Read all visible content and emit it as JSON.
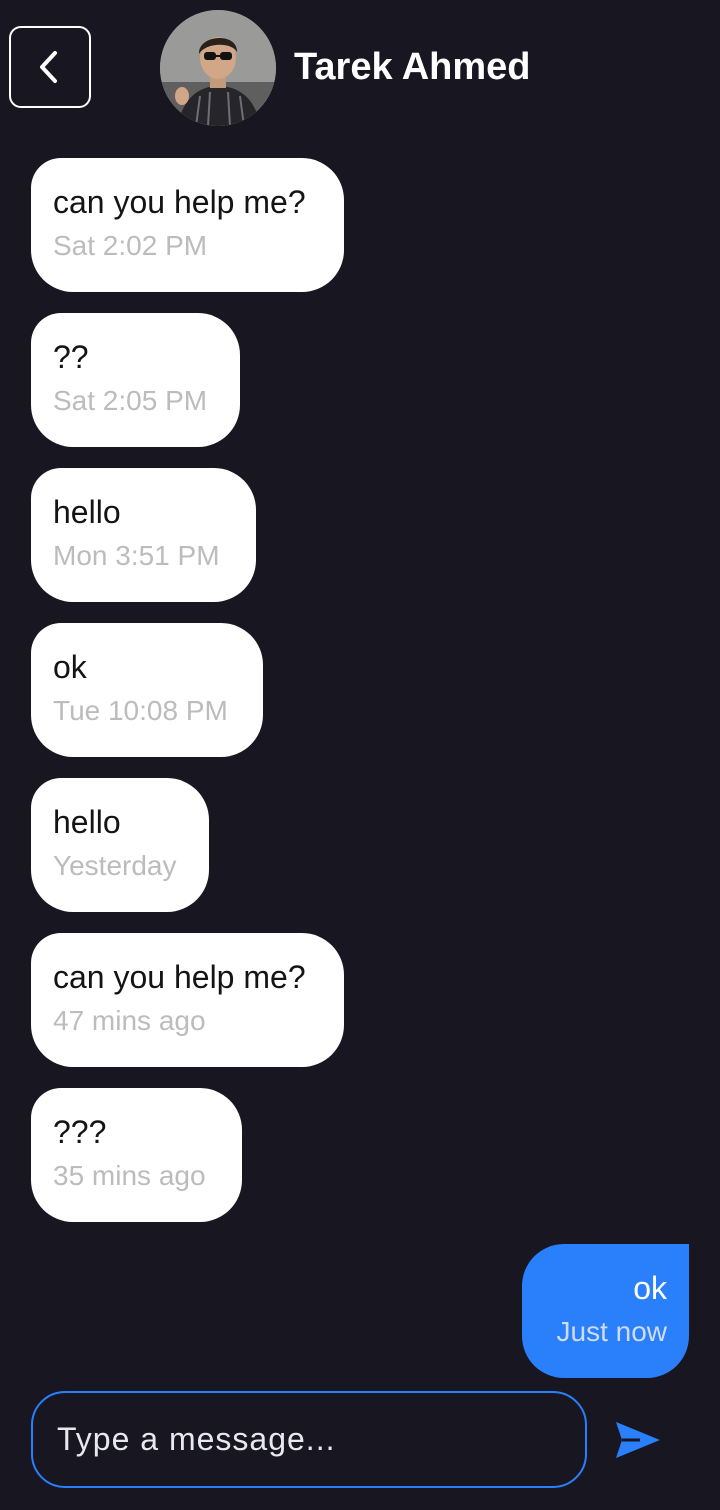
{
  "header": {
    "contact_name": "Tarek Ahmed"
  },
  "messages": [
    {
      "direction": "incoming",
      "text": "can you help me?",
      "time": "Sat 2:02 PM"
    },
    {
      "direction": "incoming",
      "text": "??",
      "time": "Sat 2:05 PM"
    },
    {
      "direction": "incoming",
      "text": "hello",
      "time": "Mon 3:51 PM"
    },
    {
      "direction": "incoming",
      "text": "ok",
      "time": "Tue 10:08 PM"
    },
    {
      "direction": "incoming",
      "text": "hello",
      "time": "Yesterday"
    },
    {
      "direction": "incoming",
      "text": "can you help me?",
      "time": "47 mins ago"
    },
    {
      "direction": "incoming",
      "text": "???",
      "time": "35 mins ago"
    },
    {
      "direction": "outgoing",
      "text": "ok",
      "time": "Just now"
    }
  ],
  "composer": {
    "placeholder": "Type a message..."
  },
  "icons": {
    "back": "chevron-left-icon",
    "send": "send-icon"
  },
  "colors": {
    "background": "#171621",
    "accent": "#2a7ffb",
    "incoming_bubble": "#ffffff",
    "timestamp": "#bcbcbc"
  }
}
